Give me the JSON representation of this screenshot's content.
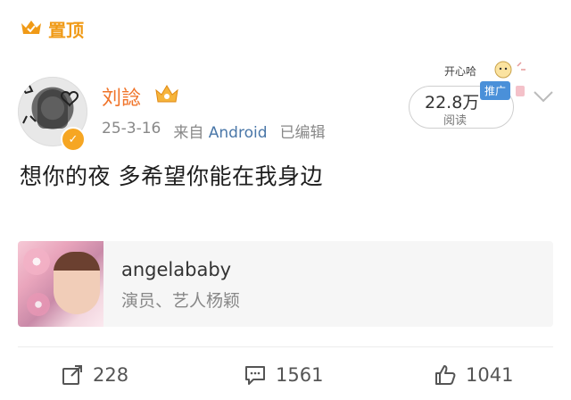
{
  "pinned": {
    "label": "置顶"
  },
  "author": {
    "name": "刘諗"
  },
  "meta": {
    "date": "25-3-16",
    "source_prefix": "来自",
    "source": "Android",
    "edited": "已编辑"
  },
  "reads": {
    "count": "22.8万",
    "label": "阅读",
    "sticker_text": "开心哈",
    "promo_tag": "推广"
  },
  "post": {
    "text": "想你的夜 多希望你能在我身边"
  },
  "card": {
    "title": "angelababy",
    "subtitle": "演员、艺人杨颖"
  },
  "actions": {
    "repost": "228",
    "comment": "1561",
    "like": "1041"
  },
  "colors": {
    "pinned": "#f09a16",
    "author": "#f0742a",
    "source": "#4a77a8",
    "badge": "#f6a623"
  },
  "icons": [
    "crown-icon",
    "verified-icon",
    "chevron-down-icon",
    "repost-icon",
    "comment-icon",
    "like-icon"
  ]
}
